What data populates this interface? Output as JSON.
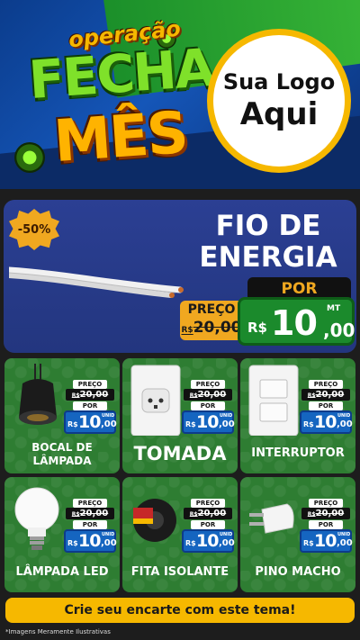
{
  "header": {
    "logo_small": "operação",
    "logo_line1": "FECHA",
    "logo_line2": "MÊS",
    "sua_logo_line1": "Sua Logo",
    "sua_logo_line2": "Aqui"
  },
  "hero": {
    "discount": "-50%",
    "title_line1": "FIO DE",
    "title_line2": "ENERGIA",
    "por_label": "POR",
    "preco_label": "PREÇO",
    "old_currency": "R$",
    "old_value": "20,00",
    "currency": "R$",
    "price_int": "10",
    "price_cents": ",00",
    "unit": "MT"
  },
  "products": [
    {
      "name": "BOCAL DE LÂMPADA",
      "preco_label": "PREÇO",
      "old_currency": "R$",
      "old_value": "20,00",
      "por_label": "POR",
      "currency": "R$",
      "price_int": "10",
      "price_cents": ",00",
      "unit": "UNID"
    },
    {
      "name": "TOMADA",
      "preco_label": "PREÇO",
      "old_currency": "R$",
      "old_value": "20,00",
      "por_label": "POR",
      "currency": "R$",
      "price_int": "10",
      "price_cents": ",00",
      "unit": "UNID"
    },
    {
      "name": "INTERRUPTOR",
      "preco_label": "PREÇO",
      "old_currency": "R$",
      "old_value": "20,00",
      "por_label": "POR",
      "currency": "R$",
      "price_int": "10",
      "price_cents": ",00",
      "unit": "UNID"
    },
    {
      "name": "LÂMPADA LED",
      "preco_label": "PREÇO",
      "old_currency": "R$",
      "old_value": "20,00",
      "por_label": "POR",
      "currency": "R$",
      "price_int": "10",
      "price_cents": ",00",
      "unit": "UNID"
    },
    {
      "name": "FITA ISOLANTE",
      "preco_label": "PREÇO",
      "old_currency": "R$",
      "old_value": "20,00",
      "por_label": "POR",
      "currency": "R$",
      "price_int": "10",
      "price_cents": ",00",
      "unit": "UNID"
    },
    {
      "name": "PINO MACHO",
      "preco_label": "PREÇO",
      "old_currency": "R$",
      "old_value": "20,00",
      "por_label": "POR",
      "currency": "R$",
      "price_int": "10",
      "price_cents": ",00",
      "unit": "UNID"
    }
  ],
  "footer": {
    "cta": "Crie seu encarte com este tema!",
    "disclaimer": "*Imagens Meramente Ilustrativas"
  },
  "colors": {
    "header_blue": "#1556b8",
    "accent_yellow": "#f6b800",
    "card_green": "#2e7d32",
    "price_green": "#1b8a2c",
    "price_blue": "#1565c0",
    "hero_blue": "#2b3f93"
  }
}
